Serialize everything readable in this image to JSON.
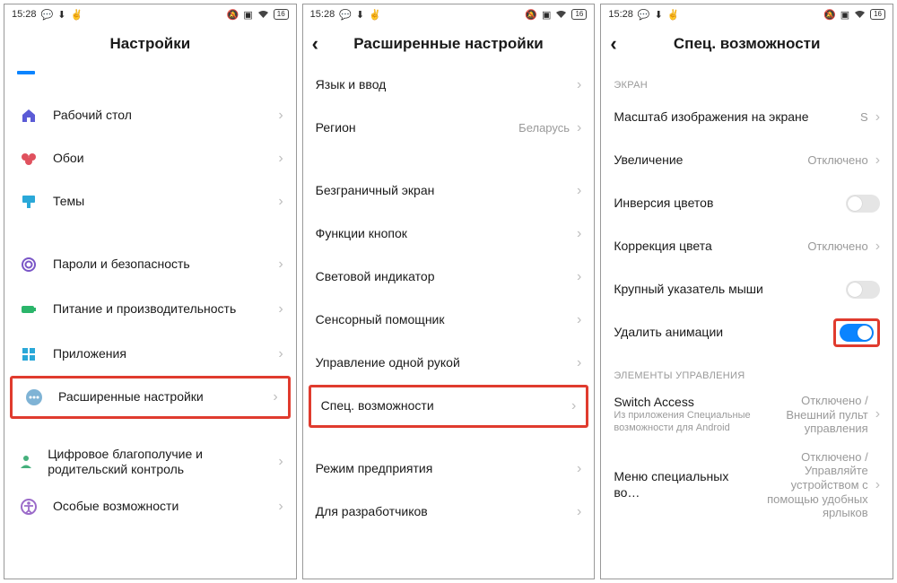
{
  "status": {
    "time": "15:28",
    "battery": "16"
  },
  "p1": {
    "title": "Настройки",
    "items": {
      "desktop": "Рабочий стол",
      "wallpaper": "Обои",
      "themes": "Темы",
      "passwords": "Пароли и безопасность",
      "power": "Питание и производительность",
      "apps": "Приложения",
      "advanced": "Расширенные настройки",
      "wellbeing": "Цифровое благополучие и родительский контроль",
      "a11y": "Особые возможности"
    }
  },
  "p2": {
    "title": "Расширенные настройки",
    "items": {
      "lang": "Язык и ввод",
      "region": "Регион",
      "region_val": "Беларусь",
      "fullscreen": "Безграничный экран",
      "buttons": "Функции кнопок",
      "led": "Световой индикатор",
      "touch": "Сенсорный помощник",
      "onehand": "Управление одной рукой",
      "access": "Спец. возможности",
      "enterprise": "Режим предприятия",
      "dev": "Для разработчиков"
    }
  },
  "p3": {
    "title": "Спец. возможности",
    "sections": {
      "screen": "ЭКРАН",
      "controls": "ЭЛЕМЕНТЫ УПРАВЛЕНИЯ"
    },
    "items": {
      "scale": "Масштаб изображения на экране",
      "scale_val": "S",
      "magnify": "Увеличение",
      "magnify_val": "Отключено",
      "invert": "Инверсия цветов",
      "colorcorr": "Коррекция цвета",
      "colorcorr_val": "Отключено",
      "bigcursor": "Крупный указатель мыши",
      "removeanim": "Удалить анимации",
      "switchaccess": "Switch Access",
      "switchaccess_sub": "Из приложения Специальные возможности для Android",
      "switchaccess_val": "Отключено / Внешний пульт управления",
      "menu": "Меню специальных во…",
      "menu_val": "Отключено / Управляйте устройством с помощью удобных ярлыков"
    }
  }
}
